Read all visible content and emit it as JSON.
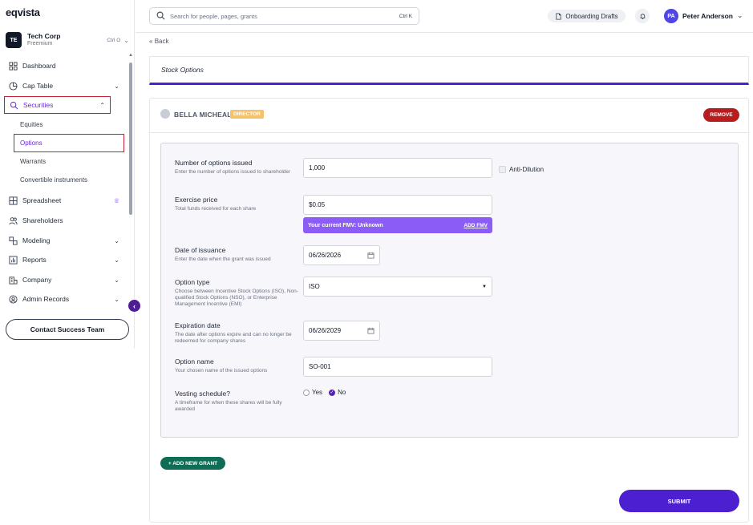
{
  "app": {
    "logo": "eqvista"
  },
  "org": {
    "initials": "TE",
    "name": "Tech Corp",
    "plan": "Freemium",
    "shortcut": "Ctrl O"
  },
  "sidebar": {
    "items": [
      {
        "label": "Dashboard",
        "icon": "dashboard-icon"
      },
      {
        "label": "Cap Table",
        "icon": "pie-chart-icon"
      },
      {
        "label": "Securities",
        "icon": "securities-icon"
      },
      {
        "label": "Spreadsheet",
        "icon": "grid-icon"
      },
      {
        "label": "Shareholders",
        "icon": "users-icon"
      },
      {
        "label": "Modeling",
        "icon": "modeling-icon"
      },
      {
        "label": "Reports",
        "icon": "reports-icon"
      },
      {
        "label": "Company",
        "icon": "company-icon"
      },
      {
        "label": "Admin Records",
        "icon": "admin-icon"
      }
    ],
    "sub_items": [
      "Equities",
      "Options",
      "Warrants",
      "Convertible instruments"
    ],
    "contact_button": "Contact Success Team"
  },
  "header": {
    "search_placeholder": "Search for people, pages, grants",
    "search_shortcut": "Ctrl K",
    "drafts_label": "Onboarding Drafts",
    "user_initials": "PA",
    "user_name": "Peter Anderson"
  },
  "main": {
    "back_label": "Back",
    "page_title": "Stock Options",
    "holder": {
      "name": "BELLA MICHEAL",
      "role": "DIRECTOR",
      "remove_label": "REMOVE"
    },
    "form": {
      "options_issued": {
        "label": "Number of options issued",
        "help": "Enter the number of options issued to shareholder",
        "value": "1,000"
      },
      "anti_dilution": {
        "label": "Anti-Dilution",
        "checked": false
      },
      "exercise_price": {
        "label": "Exercise price",
        "help": "Total funds received for each share",
        "value": "$0.05"
      },
      "fmv": {
        "text": "Your current FMV: Unknown",
        "action": "ADD FMV"
      },
      "issuance_date": {
        "label": "Date of issuance",
        "help": "Enter the date when the grant was issued",
        "value": "06/26/2026"
      },
      "option_type": {
        "label": "Option type",
        "help": "Choose between Incentive Stock Options (ISO), Non-qualified Stock Options (NSO), or Enterprise Management Incentive (EMI)",
        "value": "ISO"
      },
      "expiration_date": {
        "label": "Expiration date",
        "help": "The date after options expire and can no longer be redeemed for company shares",
        "value": "06/26/2029"
      },
      "option_name": {
        "label": "Option name",
        "help": "Your chosen name of the issued options",
        "value": "SO-001"
      },
      "vesting": {
        "label": "Vesting schedule?",
        "help": "A timeframe for when these shares will be fully awarded",
        "yes_label": "Yes",
        "no_label": "No",
        "selected": "No"
      }
    },
    "add_grant_label": "+ ADD NEW GRANT",
    "submit_label": "SUBMIT"
  },
  "colors": {
    "accent": "#4c1fd1",
    "highlight_border": "#c0202f",
    "remove": "#b91c1c",
    "add_grant": "#0f6d55",
    "fmv_bar": "#8b5cf6"
  }
}
